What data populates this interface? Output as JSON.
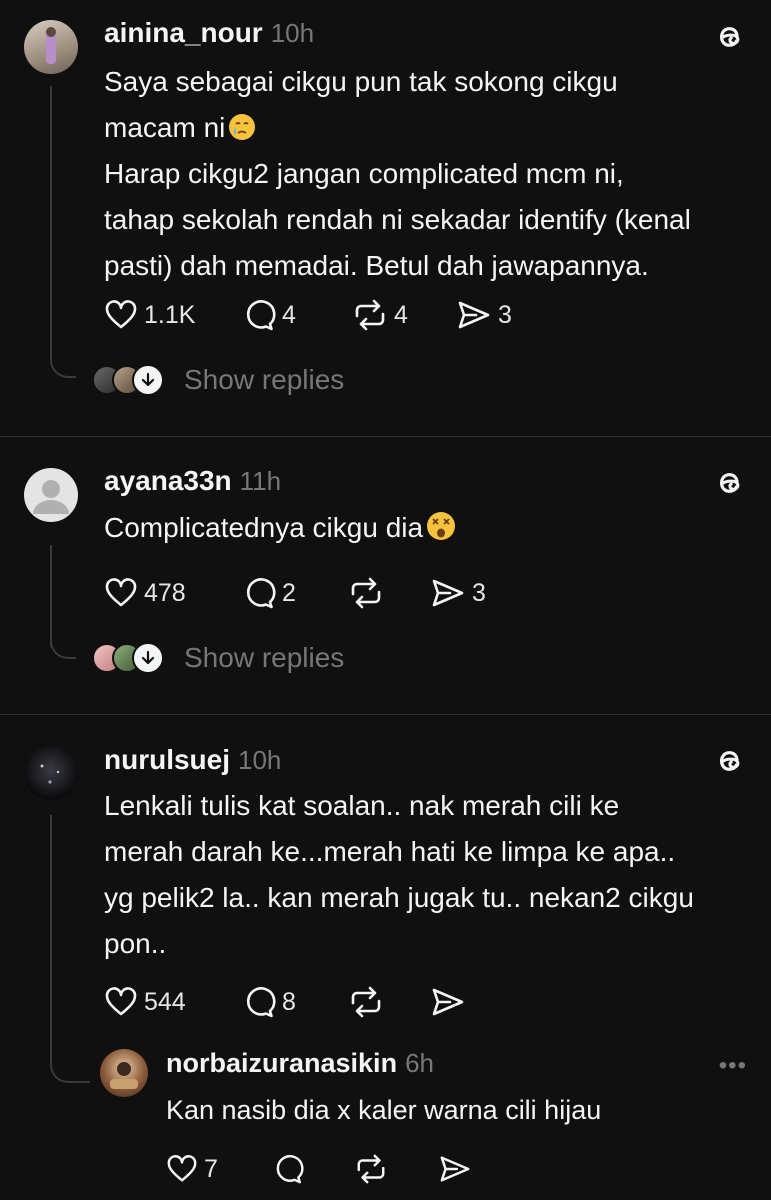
{
  "colors": {
    "background": "#101010",
    "text": "#f3f5f7",
    "muted": "#777777",
    "divider": "#2e2e2e"
  },
  "posts": [
    {
      "username": "ainina_nour",
      "time": "10h",
      "lines": [
        "Saya sebagai cikgu pun tak sokong cikgu",
        "macam ni",
        "Harap cikgu2 jangan complicated mcm ni,",
        "tahap sekolah rendah ni sekadar identify (kenal",
        "pasti) dah memadai. Betul dah jawapannya."
      ],
      "emoji": "crying-face",
      "likes": "1.1K",
      "comments": "4",
      "reposts": "4",
      "shares": "3",
      "show_replies": "Show replies"
    },
    {
      "username": "ayana33n",
      "time": "11h",
      "lines": [
        "Complicatednya cikgu dia"
      ],
      "emoji": "dizzy-face",
      "likes": "478",
      "comments": "2",
      "reposts": "",
      "shares": "3",
      "show_replies": "Show replies"
    },
    {
      "username": "nurulsuej",
      "time": "10h",
      "lines": [
        "Lenkali tulis kat soalan.. nak merah cili ke",
        "merah darah ke...merah hati ke limpa ke apa..",
        "yg pelik2 la.. kan merah jugak tu.. nekan2 cikgu",
        "pon.."
      ],
      "likes": "544",
      "comments": "8",
      "reposts": "",
      "shares": ""
    }
  ],
  "reply": {
    "username": "norbaizuranasikin",
    "time": "6h",
    "text": "Kan nasib dia x kaler warna cili hijau",
    "likes": "7",
    "more": "•••"
  }
}
